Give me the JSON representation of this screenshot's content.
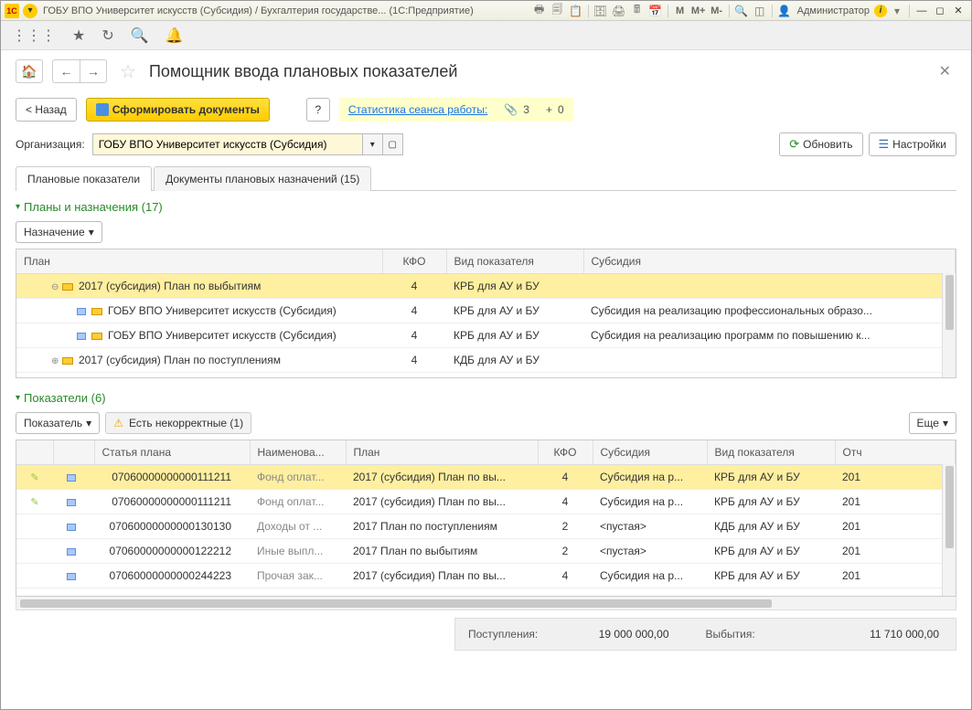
{
  "title_bar": {
    "title": "ГОБУ ВПО Университет искусств (Субсидия) / Бухгалтерия государстве...  (1С:Предприятие)",
    "m1": "M",
    "m2": "M+",
    "m3": "M-",
    "admin": "Администратор"
  },
  "page": {
    "title": "Помощник ввода плановых показателей",
    "back": "< Назад",
    "form_docs": "Сформировать документы",
    "q": "?",
    "stat_label": "Статистика сеанса работы:",
    "stat_attach": "3",
    "stat_plus": "0",
    "org_label": "Организация:",
    "org_value": "ГОБУ ВПО Университет искусств (Субсидия)",
    "refresh": "Обновить",
    "settings": "Настройки"
  },
  "tabs": {
    "t1": "Плановые показатели",
    "t2": "Документы плановых назначений (15)"
  },
  "plans": {
    "title": "Планы и назначения (17)",
    "btn": "Назначение",
    "cols": {
      "c1": "План",
      "c2": "КФО",
      "c3": "Вид показателя",
      "c4": "Субсидия"
    },
    "rows": [
      {
        "indent": 1,
        "exp": "⊖",
        "name": "2017 (субсидия) План по выбытиям",
        "kfo": "4",
        "vid": "КРБ для АУ и БУ",
        "sub": "",
        "sel": true
      },
      {
        "indent": 2,
        "doc": true,
        "name": "ГОБУ ВПО Университет искусств (Субсидия)",
        "kfo": "4",
        "vid": "КРБ для АУ и БУ",
        "sub": "Субсидия на реализацию профессиональных образо..."
      },
      {
        "indent": 2,
        "doc": true,
        "name": "ГОБУ ВПО Университет искусств (Субсидия)",
        "kfo": "4",
        "vid": "КРБ для АУ и БУ",
        "sub": "Субсидия на реализацию программ по повышению к..."
      },
      {
        "indent": 1,
        "exp": "⊕",
        "name": "2017 (субсидия) План по поступлениям",
        "kfo": "4",
        "vid": "КДБ для АУ и БУ",
        "sub": ""
      }
    ]
  },
  "indicators": {
    "title": "Показатели (6)",
    "btn": "Показатель",
    "warn": "Есть некорректные (1)",
    "more": "Еще",
    "cols": {
      "c1": "",
      "c2": "",
      "c3": "Статья плана",
      "c4": "Наименова...",
      "c5": "План",
      "c6": "КФО",
      "c7": "Субсидия",
      "c8": "Вид показателя",
      "c9": "Отч"
    },
    "rows": [
      {
        "pencil": true,
        "art": "07060000000000111211",
        "name": "Фонд оплат...",
        "plan": "2017 (субсидия) План по вы...",
        "kfo": "4",
        "sub": "Субсидия на р...",
        "vid": "КРБ для АУ и БУ",
        "ot": "201",
        "sel": true
      },
      {
        "pencil": true,
        "art": "07060000000000111211",
        "name": "Фонд оплат...",
        "plan": "2017 (субсидия) План по вы...",
        "kfo": "4",
        "sub": "Субсидия на р...",
        "vid": "КРБ для АУ и БУ",
        "ot": "201"
      },
      {
        "art": "07060000000000130130",
        "name": "Доходы от ...",
        "plan": "2017 План по поступлениям",
        "kfo": "2",
        "sub": "<пустая>",
        "vid": "КДБ для АУ и БУ",
        "ot": "201"
      },
      {
        "art": "07060000000000122212",
        "name": "Иные выпл...",
        "plan": "2017 План по выбытиям",
        "kfo": "2",
        "sub": "<пустая>",
        "vid": "КРБ для АУ и БУ",
        "ot": "201"
      },
      {
        "art": "07060000000000244223",
        "name": "Прочая зак...",
        "plan": "2017 (субсидия) План по вы...",
        "kfo": "4",
        "sub": "Субсидия на р...",
        "vid": "КРБ для АУ и БУ",
        "ot": "201"
      }
    ]
  },
  "footer": {
    "in_label": "Поступления:",
    "in_val": "19 000 000,00",
    "out_label": "Выбытия:",
    "out_val": "11 710 000,00"
  }
}
